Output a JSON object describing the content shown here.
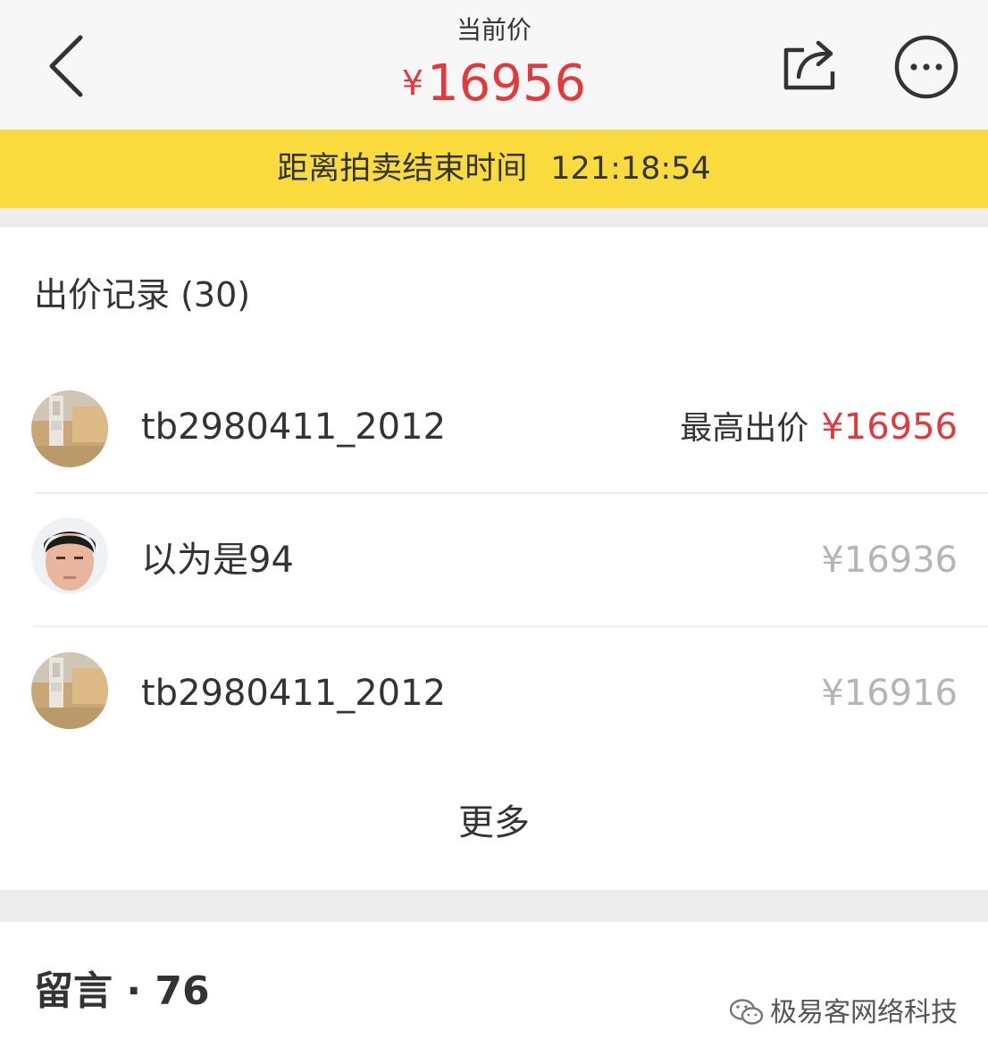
{
  "header": {
    "caption": "当前价",
    "price_symbol": "¥",
    "price_value": "16956",
    "back_icon": "chevron-left-icon",
    "share_icon": "share-icon",
    "more_icon": "more-icon",
    "accent_color": "#e4393c"
  },
  "countdown": {
    "label": "距离拍卖结束时间",
    "time": "121:18:54",
    "background": "#fadb3e"
  },
  "bids": {
    "title": "出价记录 (30)",
    "highest_label": "最高出价",
    "items": [
      {
        "name": "tb2980411_2012",
        "price": "¥16956",
        "avatar": "avatar-photo"
      },
      {
        "name": "以为是94",
        "price": "¥16936",
        "avatar": "avatar-photo"
      },
      {
        "name": "tb2980411_2012",
        "price": "¥16916",
        "avatar": "avatar-photo"
      }
    ],
    "more_label": "更多"
  },
  "comments": {
    "title": "留言 · 76"
  },
  "watermark": {
    "text": "极易客网络科技",
    "icon": "wechat-icon"
  }
}
